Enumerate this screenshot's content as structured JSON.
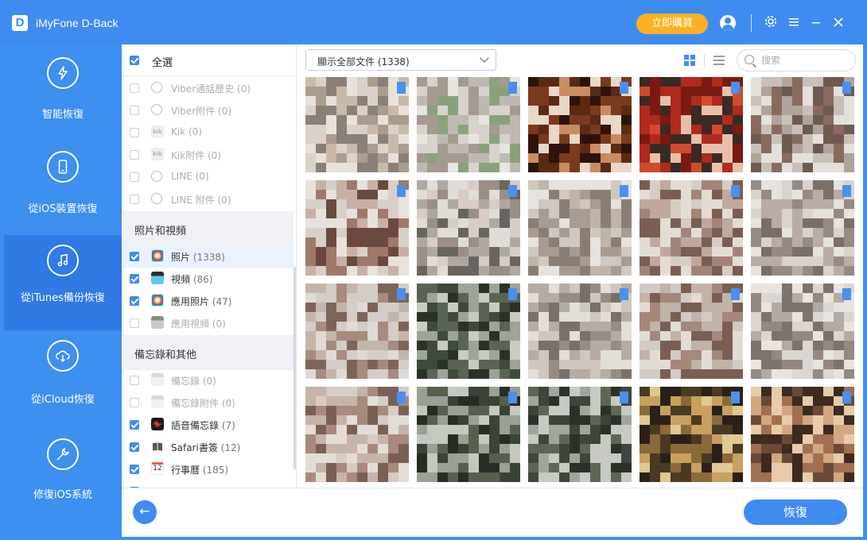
{
  "app": {
    "title": "iMyFone D-Back",
    "logo_letter": "D",
    "buy_label": "立即購買"
  },
  "window_controls": [
    "settings-icon",
    "menu-icon",
    "minimize-icon",
    "close-icon"
  ],
  "sidebar": {
    "items": [
      {
        "label": "智能恢復",
        "icon": "smart-recovery-icon",
        "active": false
      },
      {
        "label": "從iOS裝置恢復",
        "icon": "iphone-icon",
        "active": false
      },
      {
        "label": "從iTunes備份恢復",
        "icon": "music-note-icon",
        "active": true
      },
      {
        "label": "從iCloud恢復",
        "icon": "cloud-download-icon",
        "active": false
      },
      {
        "label": "修復iOS系統",
        "icon": "wrench-icon",
        "active": false
      }
    ]
  },
  "categories": {
    "select_all_label": "全選",
    "select_all_checked": true,
    "group1_items": [
      {
        "name": "Viber通話歷史",
        "count": "(0)",
        "checked": false,
        "enabled": false,
        "icon": "viber-icon"
      },
      {
        "name": "Viber附件",
        "count": "(0)",
        "checked": false,
        "enabled": false,
        "icon": "viber-icon"
      },
      {
        "name": "Kik",
        "count": "(0)",
        "checked": false,
        "enabled": false,
        "icon": "kik-icon"
      },
      {
        "name": "Kik附件",
        "count": "(0)",
        "checked": false,
        "enabled": false,
        "icon": "kik-icon"
      },
      {
        "name": "LINE",
        "count": "(0)",
        "checked": false,
        "enabled": false,
        "icon": "line-icon"
      },
      {
        "name": "LINE 附件",
        "count": "(0)",
        "checked": false,
        "enabled": false,
        "icon": "line-icon"
      }
    ],
    "section_photos": "照片和視頻",
    "photo_items": [
      {
        "name": "照片",
        "count": "(1338)",
        "checked": true,
        "enabled": true,
        "selected": true,
        "icon": "photos-icon"
      },
      {
        "name": "視頻",
        "count": "(86)",
        "checked": true,
        "enabled": true,
        "icon": "video-icon"
      },
      {
        "name": "應用照片",
        "count": "(47)",
        "checked": true,
        "enabled": true,
        "icon": "app-photos-icon"
      },
      {
        "name": "應用視頻",
        "count": "(0)",
        "checked": false,
        "enabled": false,
        "icon": "app-video-icon"
      }
    ],
    "section_notes": "備忘錄和其他",
    "note_items": [
      {
        "name": "備忘錄",
        "count": "(0)",
        "checked": false,
        "enabled": false,
        "icon": "notes-icon"
      },
      {
        "name": "備忘錄附件",
        "count": "(0)",
        "checked": false,
        "enabled": false,
        "icon": "notes-icon"
      },
      {
        "name": "語音備忘錄",
        "count": "(7)",
        "checked": true,
        "enabled": true,
        "icon": "voice-memo-icon"
      },
      {
        "name": "Safari書簽",
        "count": "(12)",
        "checked": true,
        "enabled": true,
        "icon": "safari-bookmark-icon"
      },
      {
        "name": "行事曆",
        "count": "(185)",
        "checked": true,
        "enabled": true,
        "icon": "calendar-icon",
        "calendar_day": "12"
      }
    ]
  },
  "toolbar": {
    "filter_value": "顯示全部文件 (1338)",
    "search_placeholder": "搜索",
    "view_mode": "grid"
  },
  "photos": {
    "thumb_palettes": [
      [
        "#c9b9a8",
        "#ab9c8e",
        "#dad2c8",
        "#8b8078",
        "#e8e2da"
      ],
      [
        "#bfb9b3",
        "#d8d2cc",
        "#8aa27c",
        "#e8e4e0",
        "#a59a90"
      ],
      [
        "#5a2a14",
        "#7a3a1c",
        "#c98c62",
        "#2e130a",
        "#e8d8c8"
      ],
      [
        "#b02a1e",
        "#d24a2e",
        "#3a2a24",
        "#e8c0a8",
        "#7c1a12"
      ],
      [
        "#8a6a5e",
        "#e4e0dc",
        "#b0a49c",
        "#c8c0b8",
        "#6e5a50"
      ],
      [
        "#a0796a",
        "#e8e2dc",
        "#c8b0a4",
        "#6a4a3e",
        "#d8d0c8"
      ],
      [
        "#b0a8a0",
        "#e0dcd8",
        "#9a8e86",
        "#d8ccc4",
        "#6a6460"
      ],
      [
        "#c0b4a8",
        "#e6e2de",
        "#8a7e74",
        "#a89c92",
        "#d0c8c0"
      ],
      [
        "#a48478",
        "#e4dcd4",
        "#c0a89c",
        "#7a5e52",
        "#d6ccc4"
      ],
      [
        "#b8aca4",
        "#dad2cc",
        "#968a84",
        "#e6e2de",
        "#7a6e66"
      ],
      [
        "#a88a7e",
        "#e0dad6",
        "#c4b4aa",
        "#7e6458",
        "#d4ccc6"
      ],
      [
        "#3e4a3a",
        "#5a6454",
        "#9ea49a",
        "#2a3228",
        "#c8ccc4"
      ],
      [
        "#b6aca4",
        "#e2ded8",
        "#968c84",
        "#cfc6be",
        "#7a706a"
      ],
      [
        "#a4887c",
        "#e2dcd6",
        "#c2b2a8",
        "#7a5e52",
        "#d2cac4"
      ],
      [
        "#b4aaa4",
        "#dcd6d2",
        "#948882",
        "#e8e4e0",
        "#7e726c"
      ],
      [
        "#a98a7c",
        "#e4ddd6",
        "#c6b4a8",
        "#7a6054",
        "#d6ccc4"
      ],
      [
        "#3a4436",
        "#56604e",
        "#9aa094",
        "#262e24",
        "#c4c8c0"
      ],
      [
        "#3e463a",
        "#5e6656",
        "#a0a69a",
        "#2c322a",
        "#c6cac2"
      ],
      [
        "#4a3a22",
        "#8a6a3a",
        "#c8a060",
        "#2a2018",
        "#e0c890"
      ],
      [
        "#6a4a36",
        "#a07050",
        "#d0a880",
        "#3e2a1e",
        "#e6cca8"
      ]
    ]
  },
  "footer": {
    "back_label": "←",
    "recover_label": "恢復"
  }
}
